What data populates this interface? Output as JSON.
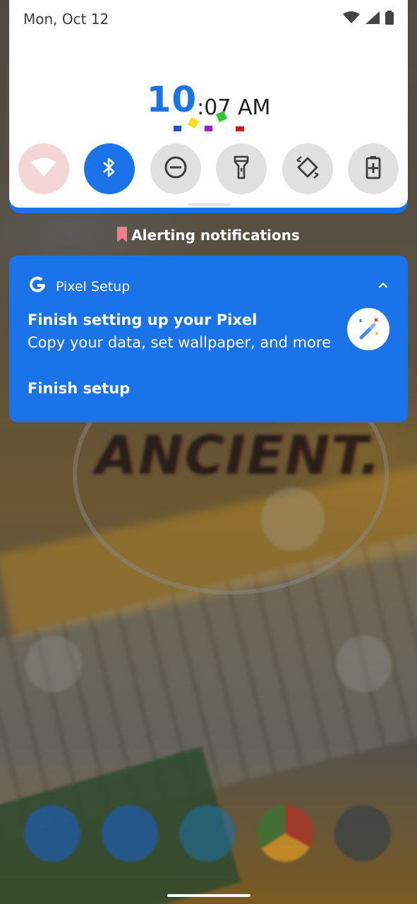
{
  "status_bar": {
    "date": "Mon, Oct 12",
    "icons": [
      "wifi-icon",
      "cellular-signal-icon",
      "battery-icon"
    ]
  },
  "clock": {
    "hour": "10",
    "separator": ":",
    "minute_ampm": "07 AM"
  },
  "quick_settings": {
    "tiles": [
      {
        "icon": "wifi-icon",
        "state": "off"
      },
      {
        "icon": "bluetooth-icon",
        "state": "on"
      },
      {
        "icon": "do-not-disturb-icon",
        "state": "off"
      },
      {
        "icon": "flashlight-icon",
        "state": "off"
      },
      {
        "icon": "auto-rotate-icon",
        "state": "off"
      },
      {
        "icon": "battery-saver-icon",
        "state": "off"
      }
    ]
  },
  "section_header": {
    "label": "Alerting notifications"
  },
  "notification": {
    "app_name": "Pixel Setup",
    "title": "Finish setting up your Pixel",
    "text": "Copy your data, set wallpaper, and more",
    "action": "Finish setup"
  },
  "wallpaper": {
    "text": "ANCIENT."
  },
  "colors": {
    "accent": "#1a73e8",
    "panel_bg": "#ffffff",
    "tile_off": "#e0e0e0",
    "tile_wifi_off": "#f5d6d6"
  }
}
